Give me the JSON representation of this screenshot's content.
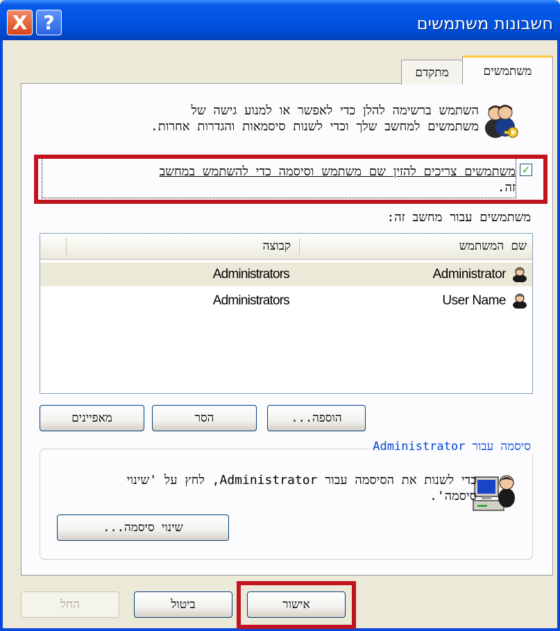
{
  "window": {
    "title": "חשבונות משתמשים"
  },
  "titlebar": {
    "close_glyph": "X",
    "help_glyph": "?"
  },
  "tabs": [
    {
      "label": "משתמשים",
      "active": true
    },
    {
      "label": "מתקדם",
      "active": false
    }
  ],
  "intro": {
    "line1": "השתמש ברשימה להלן כדי לאפשר או למנוע גישה של",
    "line2": "משתמשים למחשב שלך וכדי לשנות סיסמאות והגדרות אחרות."
  },
  "require_login": {
    "checked": true,
    "line1": "משתמשים צריכים להזין שם משתמש וסיסמה כדי להשתמש במחשב",
    "line2": "זה."
  },
  "users_label": "משתמשים עבור מחשב זה:",
  "users_table": {
    "columns": [
      "שם המשתמש",
      "קבוצה"
    ],
    "rows": [
      {
        "name": "Administrator",
        "group": "Administrators",
        "selected": true
      },
      {
        "name": "User Name",
        "group": "Administrators",
        "selected": false
      }
    ]
  },
  "list_buttons": {
    "add": "הוספה...",
    "remove": "הסר",
    "properties": "מאפיינים"
  },
  "password_group": {
    "legend": "סיסמה עבור Administrator",
    "line1": "כדי לשנות את הסיסמה עבור Administrator, לחץ על 'שינוי",
    "line2": "סיסמה'.",
    "button": "שינוי סיסמה..."
  },
  "footer_buttons": {
    "ok": "אישור",
    "cancel": "ביטול",
    "apply": "החל"
  },
  "colors": {
    "titlebar": "#0054e3",
    "highlight": "#c0151f",
    "dialog_bg": "#ece9d8",
    "tab_accent": "#ffc83c",
    "legend_text": "#0046d5"
  },
  "icons": {
    "users": "users-key-icon",
    "user_row": "user-icon",
    "computer": "computer-user-icon",
    "checkbox": "checkmark-icon"
  }
}
